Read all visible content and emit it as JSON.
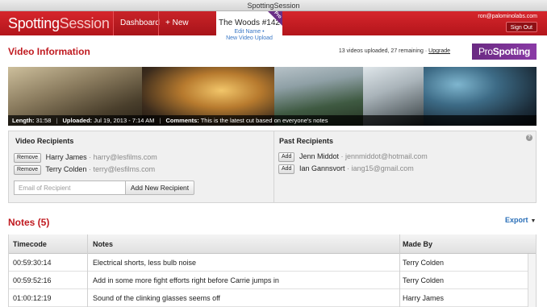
{
  "window": {
    "title": "SpottingSession"
  },
  "header": {
    "logo_a": "Spotting",
    "logo_b": "Session",
    "nav_dashboard": "Dashboard",
    "nav_new_session": "+ New Session",
    "video_tab": {
      "title": "The Woods #142",
      "edit_name": "Edit Name",
      "separator": "•",
      "new_video_upload": "New Video Upload",
      "ribbon": "Pro"
    },
    "user_email": "ron@palominolabs.com",
    "sign_out": "Sign Out"
  },
  "video_info": {
    "title": "Video Information",
    "uploads_text": "13 videos uploaded, 27 remaining ·",
    "upgrade_link": "Upgrade",
    "pro_badge_a": "Pro",
    "pro_badge_b": "Spotting",
    "length_label": "Length:",
    "length_value": "31:58",
    "uploaded_label": "Uploaded:",
    "uploaded_value": "Jul 19, 2013 - 7:14 AM",
    "comments_label": "Comments:",
    "comments_value": "This is the latest cut based on everyone's notes",
    "sep": "|"
  },
  "recipients": {
    "video_heading": "Video Recipients",
    "past_heading": "Past Recipients",
    "help_icon": "?",
    "video_list": [
      {
        "button": "Remove",
        "name": "Harry James",
        "email": "· harry@lesfilms.com"
      },
      {
        "button": "Remove",
        "name": "Terry Colden",
        "email": "· terry@lesfilms.com"
      }
    ],
    "past_list": [
      {
        "button": "Add",
        "name": "Jenn Middot",
        "email": "· jennmiddot@hotmail.com"
      },
      {
        "button": "Add",
        "name": "Ian Gannsvort",
        "email": "· iang15@gmail.com"
      }
    ],
    "email_placeholder": "Email of Recipient",
    "add_new_button": "Add New Recipient"
  },
  "notes": {
    "title": "Notes (5)",
    "export_label": "Export",
    "columns": {
      "timecode": "Timecode",
      "notes": "Notes",
      "made_by": "Made By"
    },
    "rows": [
      {
        "timecode": "00:59:30:14",
        "note": "Electrical shorts, less bulb noise",
        "by": "Terry Colden"
      },
      {
        "timecode": "00:59:52:16",
        "note": "Add in some more fight efforts right before Carrie jumps in",
        "by": "Terry Colden"
      },
      {
        "timecode": "01:00:12:19",
        "note": "Sound of the clinking glasses seems off",
        "by": "Harry James"
      }
    ]
  },
  "colors": {
    "brand_red": "#c01a20",
    "pro_purple": "#6a2a82",
    "link_blue": "#2a6fb8"
  }
}
